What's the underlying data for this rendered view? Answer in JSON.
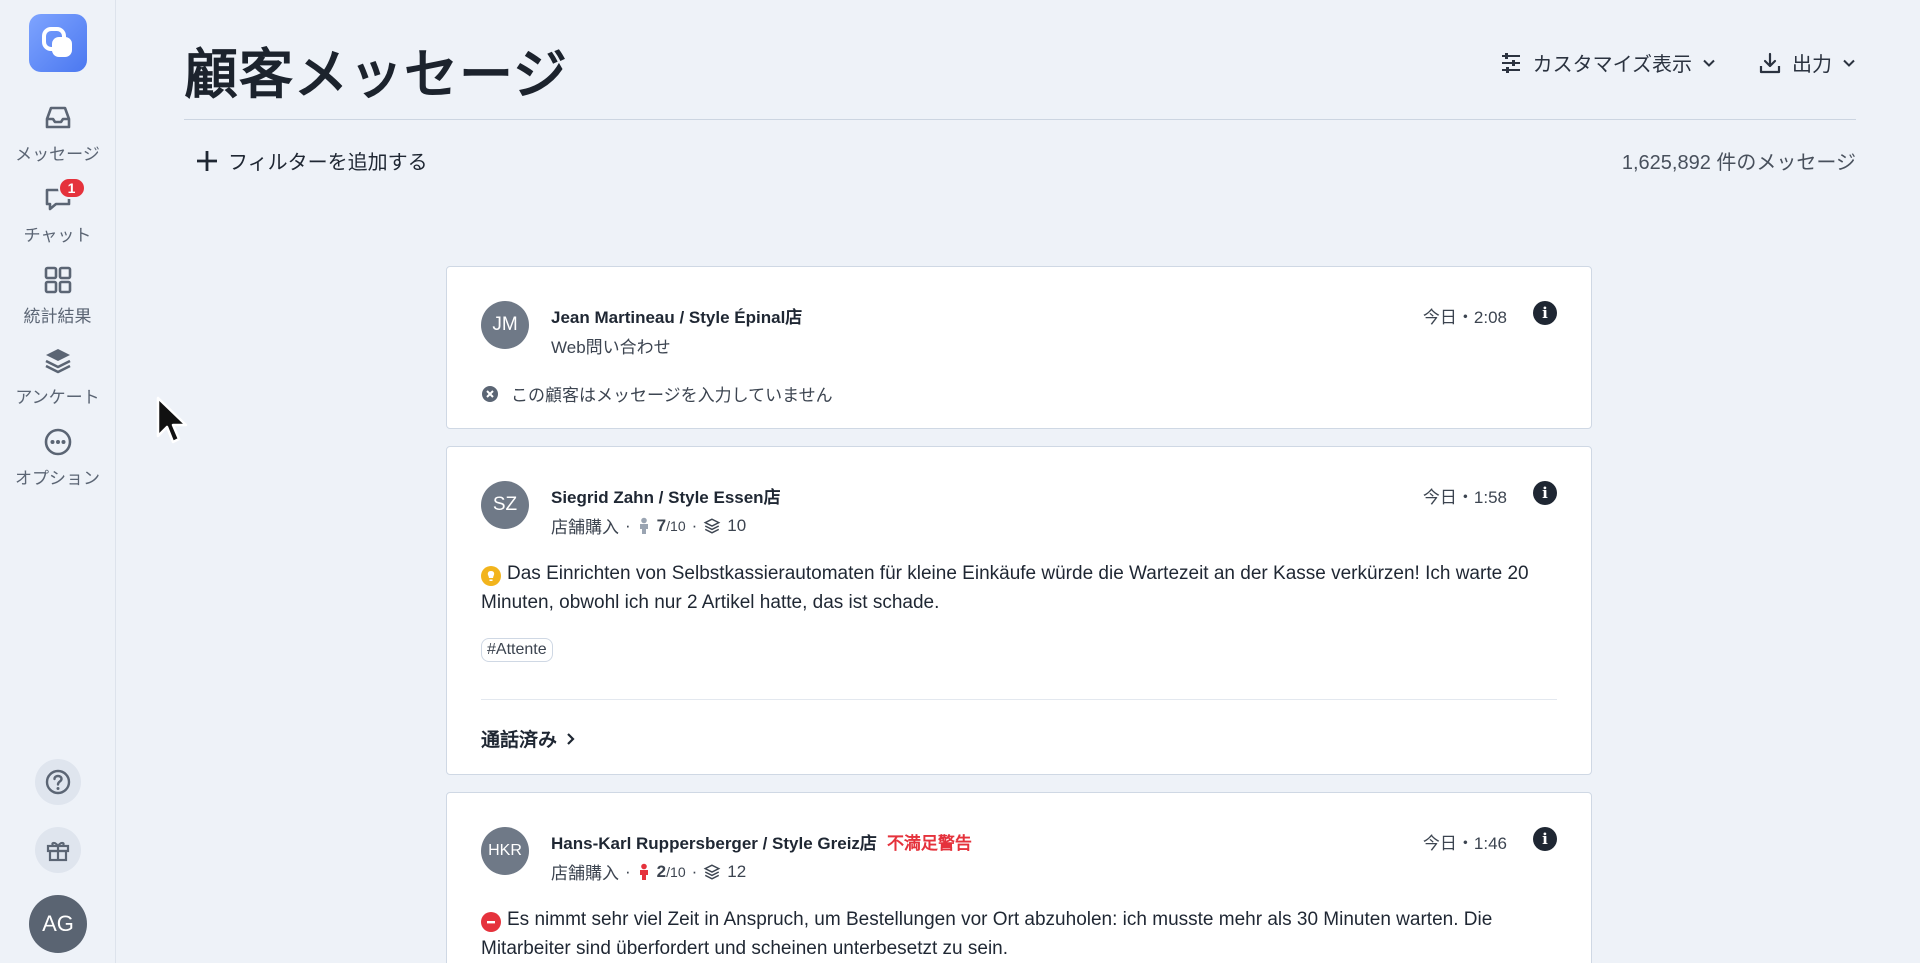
{
  "sidebar": {
    "items": [
      {
        "label": "メッセージ",
        "icon": "inbox-icon"
      },
      {
        "label": "チャット",
        "icon": "chat-icon",
        "badge": "1"
      },
      {
        "label": "統計結果",
        "icon": "grid-icon"
      },
      {
        "label": "アンケート",
        "icon": "layers-icon"
      },
      {
        "label": "オプション",
        "icon": "more-icon"
      }
    ],
    "user_initials": "AG"
  },
  "header": {
    "title": "顧客メッセージ",
    "customize_label": "カスタマイズ表示",
    "export_label": "出力"
  },
  "filter": {
    "add_label": "フィルターを追加する",
    "count_label": "1,625,892 件のメッセージ"
  },
  "cards": [
    {
      "initials": "JM",
      "name": "Jean Martineau / Style Épinal店",
      "time": "今日・2:08",
      "channel": "Web問い合わせ",
      "no_message": "この顧客はメッセージを入力していません"
    },
    {
      "initials": "SZ",
      "name": "Siegrid Zahn / Style Essen店",
      "time": "今日・1:58",
      "channel": "店舗購入",
      "score": "7",
      "score_max": "/10",
      "count": "10",
      "message": "Das Einrichten von Selbstkassierautomaten für kleine Einkäufe würde die Wartezeit an der Kasse verkürzen! Ich warte 20 Minuten, obwohl ich nur 2 Artikel hatte, das ist schade.",
      "tag": "#Attente",
      "status": "通話済み"
    },
    {
      "initials": "HKR",
      "name": "Hans-Karl Ruppersberger / Style Greiz店",
      "warning": "不満足警告",
      "time": "今日・1:46",
      "channel": "店舗購入",
      "score": "2",
      "score_max": "/10",
      "count": "12",
      "message": "Es nimmt sehr viel Zeit in Anspruch, um Bestellungen vor Ort abzuholen: ich musste mehr als 30 Minuten warten. Die Mitarbeiter sind überfordert und scheinen unterbesetzt zu sein."
    }
  ],
  "colors": {
    "accent": "#4b78f0",
    "warning": "#e5323c",
    "idea": "#f2b41c"
  }
}
